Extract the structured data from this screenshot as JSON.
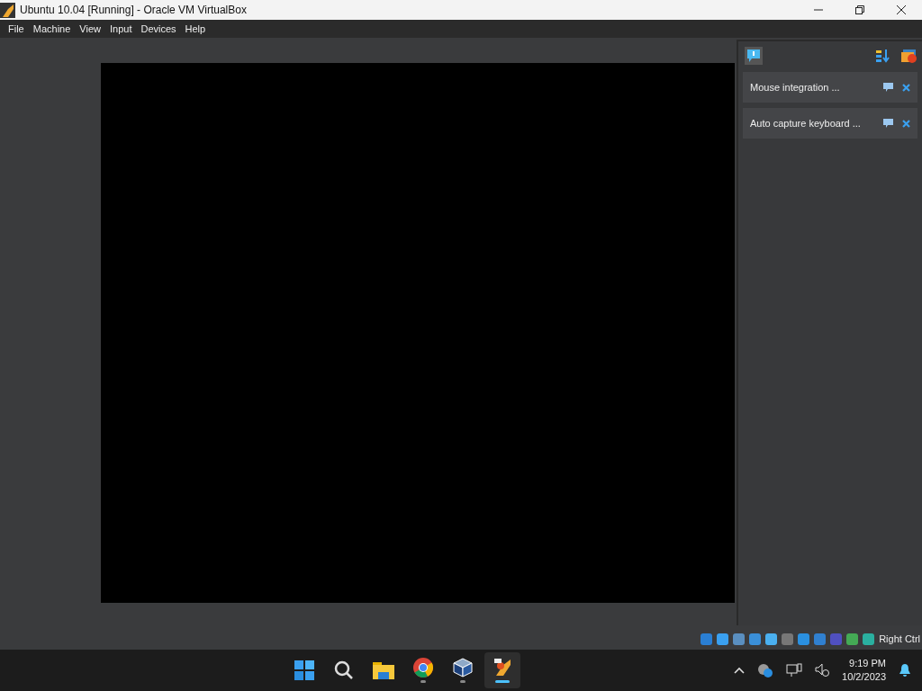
{
  "window": {
    "title": "Ubuntu 10.04 [Running] - Oracle VM VirtualBox"
  },
  "menu": [
    "File",
    "Machine",
    "View",
    "Input",
    "Devices",
    "Help"
  ],
  "notifications": {
    "items": [
      {
        "text": "Mouse integration ..."
      },
      {
        "text": "Auto capture keyboard ..."
      }
    ]
  },
  "status_bar": {
    "host_key": "Right Ctrl"
  },
  "taskbar": {
    "apps": [
      {
        "kind": "start",
        "running": false,
        "selected": false
      },
      {
        "kind": "search",
        "running": false,
        "selected": false
      },
      {
        "kind": "folder",
        "running": false,
        "selected": false
      },
      {
        "kind": "browser",
        "running": true,
        "selected": false
      },
      {
        "kind": "cube",
        "running": true,
        "selected": false
      },
      {
        "kind": "vm",
        "running": true,
        "selected": true
      }
    ],
    "time": "9:19 PM",
    "date": "10/2/2023"
  }
}
